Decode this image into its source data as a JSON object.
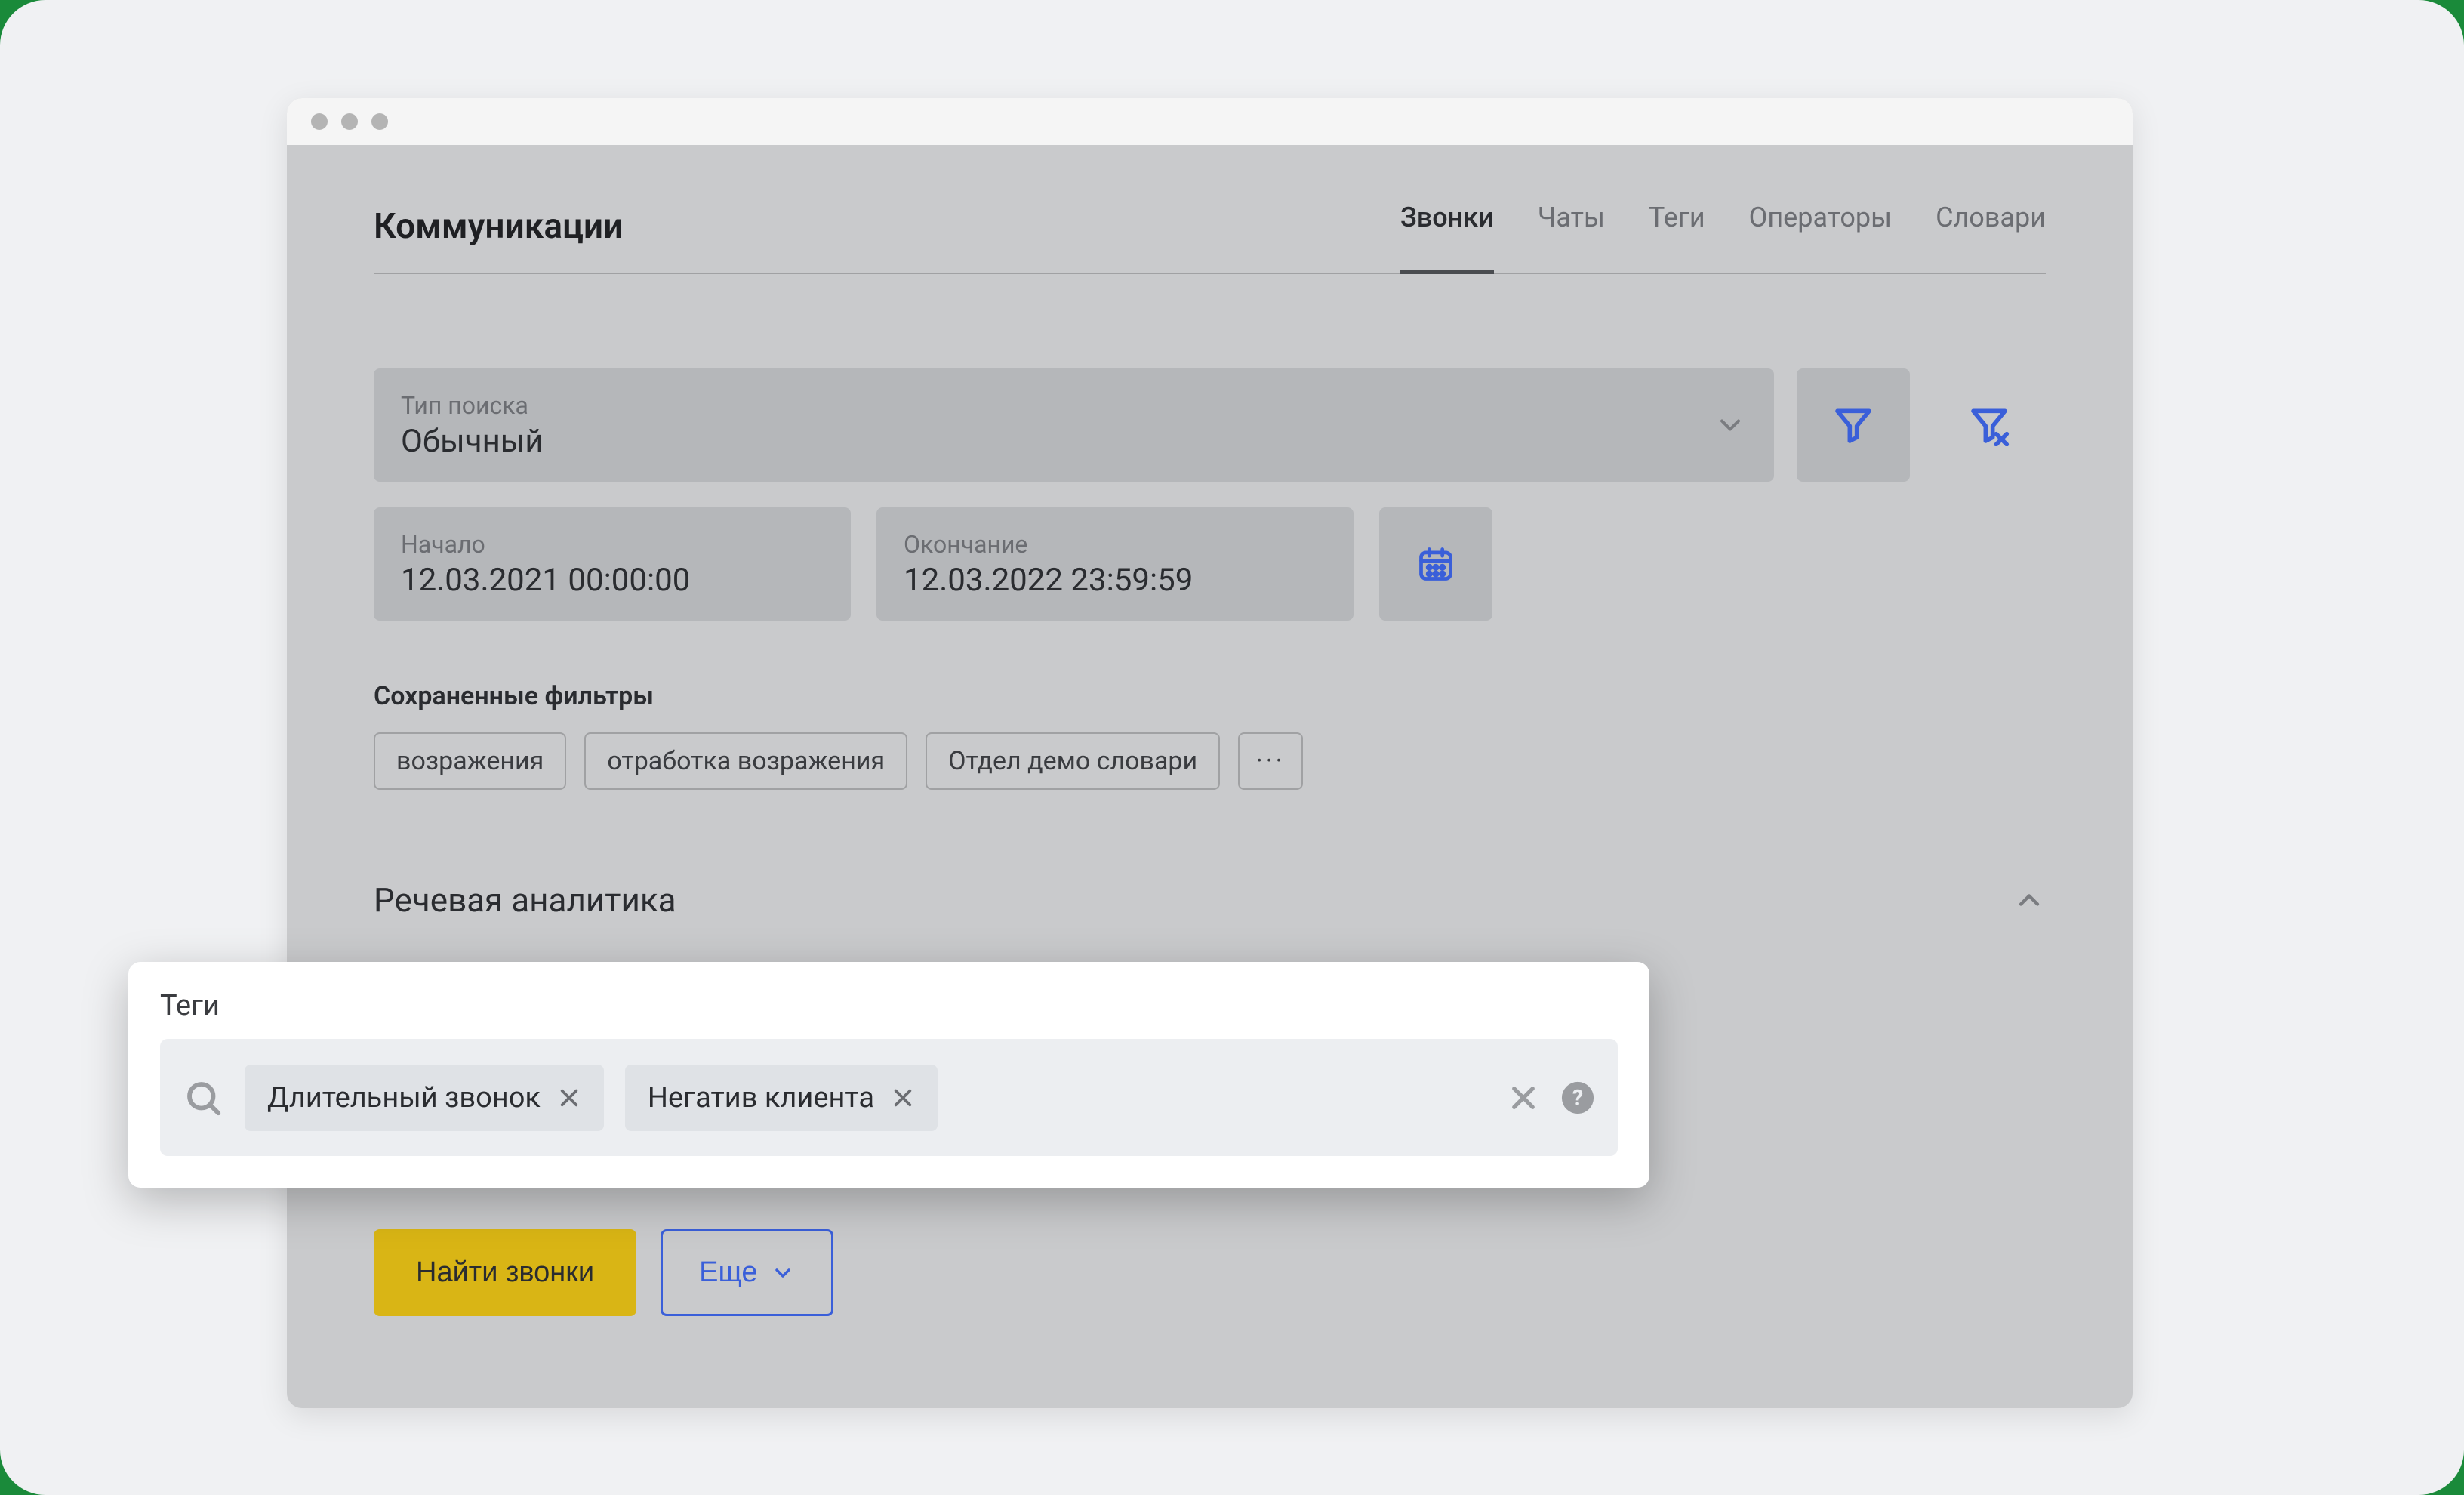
{
  "header": {
    "title": "Коммуникации",
    "tabs": [
      "Звонки",
      "Чаты",
      "Теги",
      "Операторы",
      "Словари"
    ],
    "active_tab_index": 0
  },
  "search_type": {
    "label": "Тип поиска",
    "value": "Обычный"
  },
  "date_start": {
    "label": "Начало",
    "value": "12.03.2021 00:00:00"
  },
  "date_end": {
    "label": "Окончание",
    "value": "12.03.2022 23:59:59"
  },
  "saved_filters": {
    "label": "Сохраненные фильтры",
    "items": [
      "возражения",
      "отработка возражения",
      "Отдел демо словари"
    ],
    "more": "···"
  },
  "speech": {
    "title": "Речевая аналитика"
  },
  "popover": {
    "title": "Теги",
    "tags": [
      "Длительный звонок",
      "Негатив клиента"
    ]
  },
  "actions": {
    "primary": "Найти звонки",
    "secondary": "Еще"
  },
  "colors": {
    "accent_blue": "#3a5fd9",
    "accent_yellow": "#d9b515"
  }
}
